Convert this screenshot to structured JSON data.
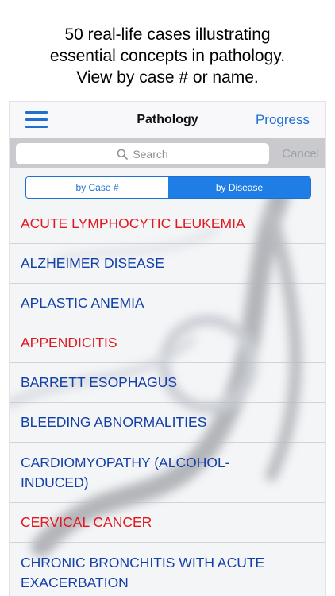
{
  "caption": {
    "line1": "50 real-life cases illustrating",
    "line2": "essential concepts in pathology.",
    "line3": "View by case # or name."
  },
  "navbar": {
    "title": "Pathology",
    "progress_label": "Progress",
    "menu_icon": "hamburger-menu-icon"
  },
  "search": {
    "placeholder": "Search",
    "cancel_label": "Cancel",
    "icon": "search-icon"
  },
  "segmented": {
    "options": [
      "by Case #",
      "by Disease"
    ],
    "selected": "by Disease"
  },
  "colors": {
    "accent": "#1f6fd1",
    "red_item": "#e0181f",
    "blue_item": "#1340a8"
  },
  "diseases": [
    {
      "name": "ACUTE LYMPHOCYTIC LEUKEMIA",
      "color": "red"
    },
    {
      "name": "ALZHEIMER DISEASE",
      "color": "blue"
    },
    {
      "name": "APLASTIC ANEMIA",
      "color": "blue"
    },
    {
      "name": "APPENDICITIS",
      "color": "red"
    },
    {
      "name": "BARRETT ESOPHAGUS",
      "color": "blue"
    },
    {
      "name": "BLEEDING ABNORMALITIES",
      "color": "blue"
    },
    {
      "name": "CARDIOMYOPATHY (ALCOHOL-\nINDUCED)",
      "color": "blue"
    },
    {
      "name": "CERVICAL CANCER",
      "color": "red"
    },
    {
      "name": "CHRONIC BRONCHITIS WITH ACUTE\nEXACERBATION",
      "color": "blue"
    }
  ]
}
